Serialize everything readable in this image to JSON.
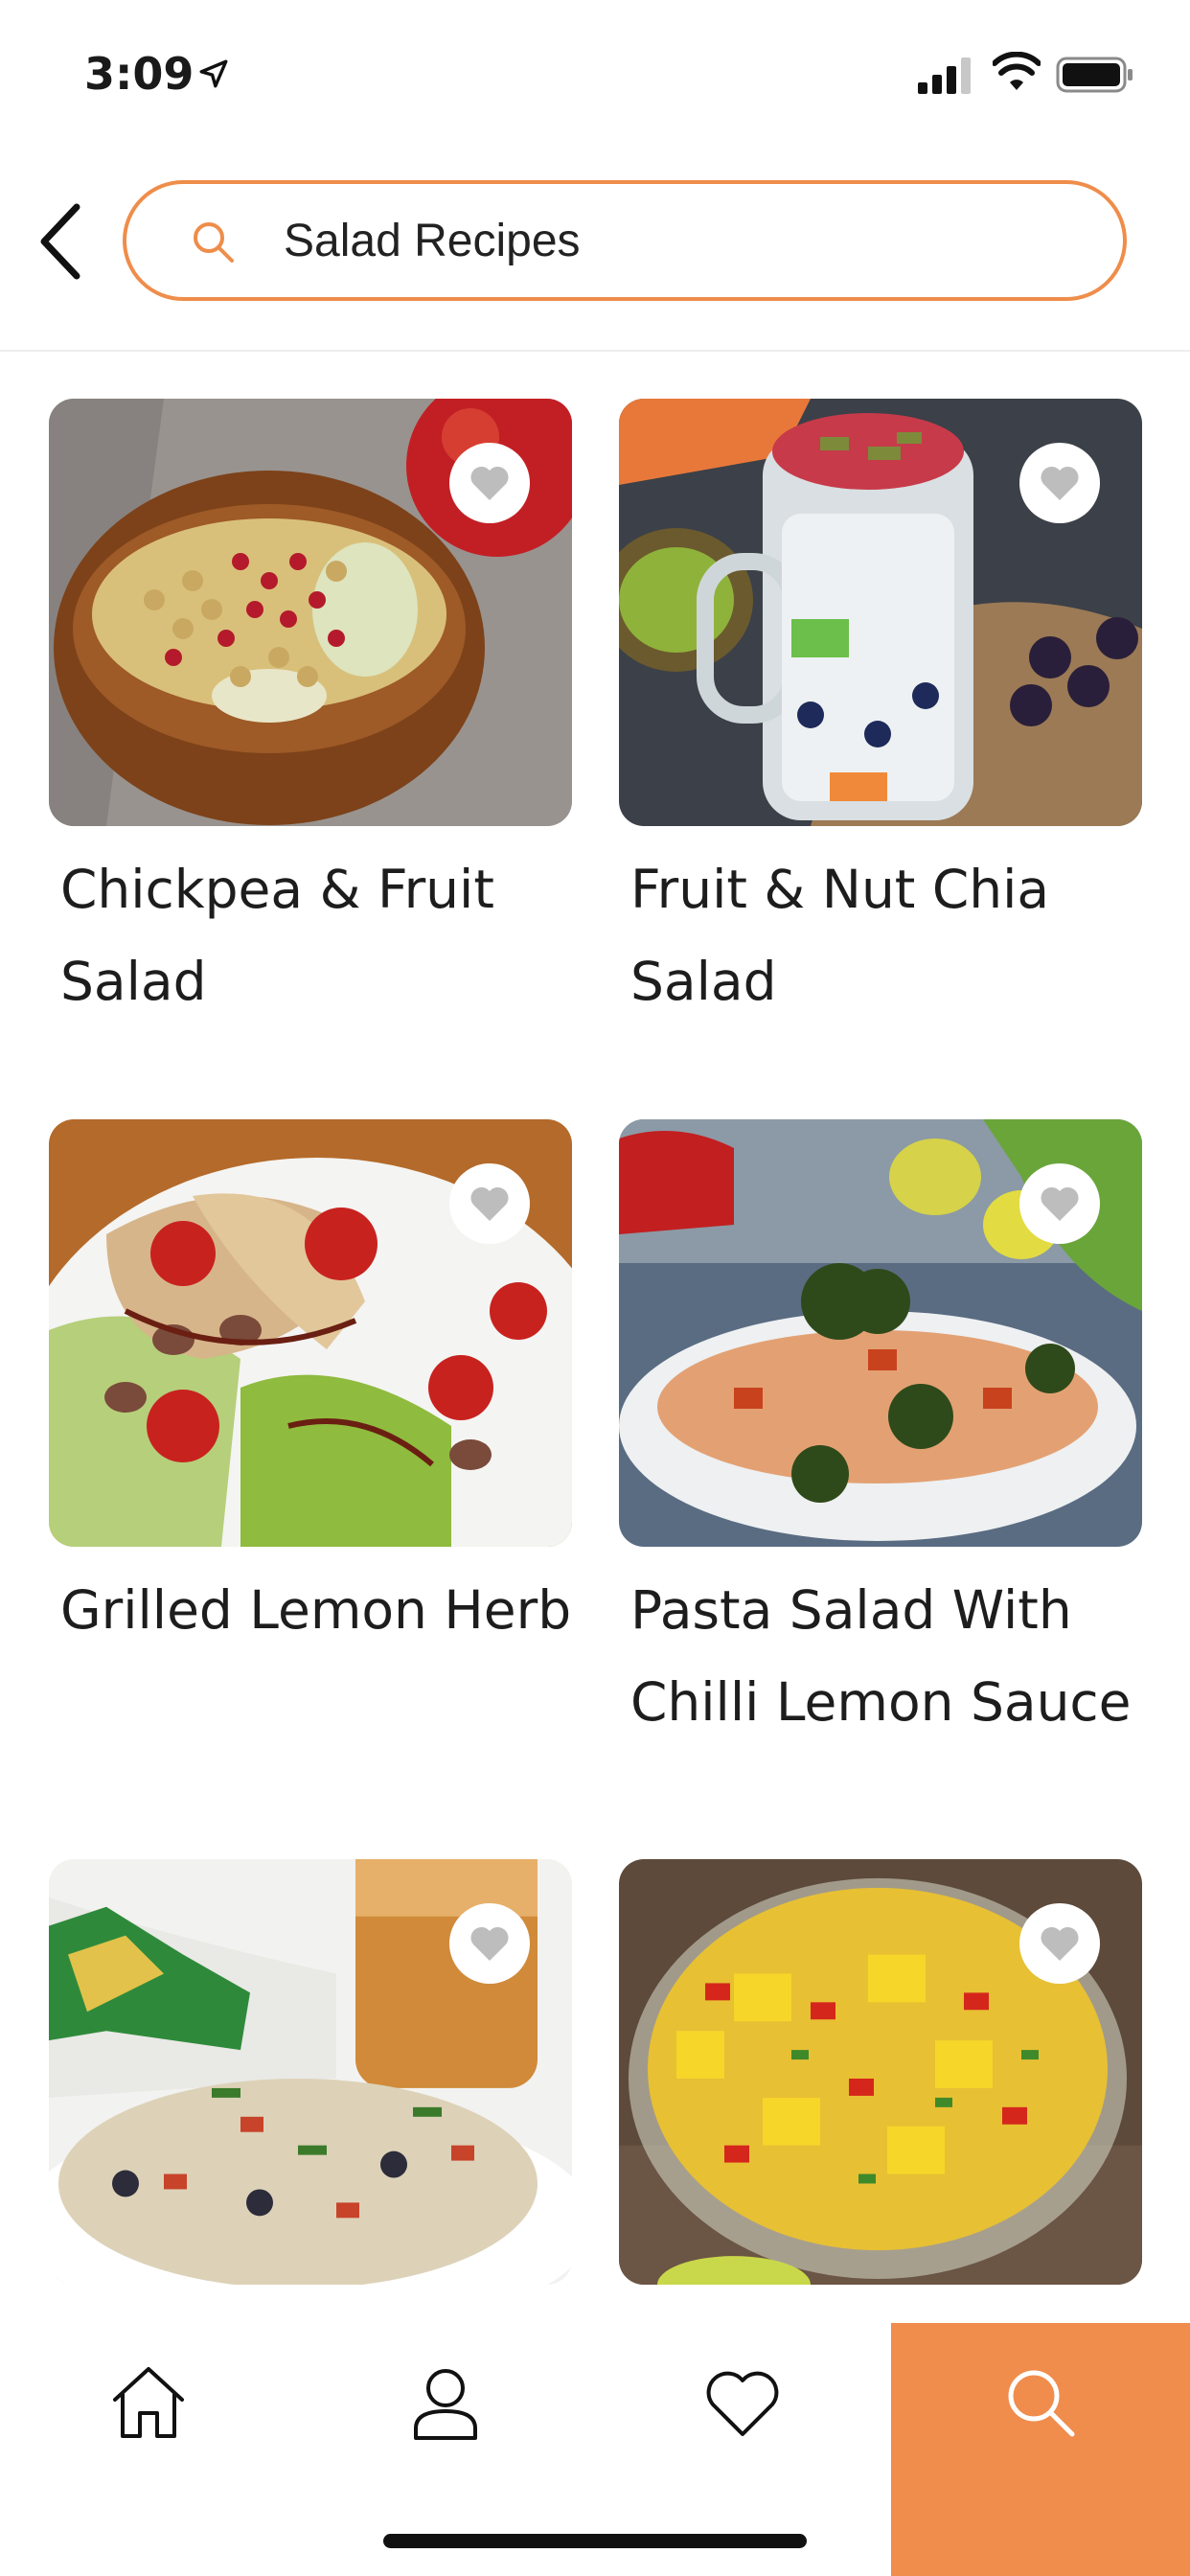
{
  "status_bar": {
    "time": "3:09",
    "icons": [
      "location-arrow-icon",
      "cellular-signal-icon",
      "wifi-icon",
      "battery-icon"
    ]
  },
  "header": {
    "back_icon": "chevron-left-icon",
    "search_icon": "search-icon",
    "search_value": "Salad Recipes"
  },
  "recipes": [
    {
      "title": "Chickpea & Fruit Salad",
      "favorite_icon": "heart-icon"
    },
    {
      "title": "Fruit & Nut Chia Salad",
      "favorite_icon": "heart-icon"
    },
    {
      "title": "Grilled Lemon Herb",
      "favorite_icon": "heart-icon"
    },
    {
      "title": "Pasta Salad With Chilli Lemon Sauce",
      "favorite_icon": "heart-icon"
    },
    {
      "title": "",
      "favorite_icon": "heart-icon"
    },
    {
      "title": "",
      "favorite_icon": "heart-icon"
    }
  ],
  "tab_bar": {
    "tabs": [
      {
        "icon": "home-icon",
        "active": false
      },
      {
        "icon": "profile-icon",
        "active": false
      },
      {
        "icon": "heart-icon",
        "active": false
      },
      {
        "icon": "search-icon",
        "active": true
      }
    ]
  },
  "colors": {
    "accent": "#f08c4c",
    "search_border": "#ef8d4a",
    "favorite_heart": "#bdbdbd"
  }
}
